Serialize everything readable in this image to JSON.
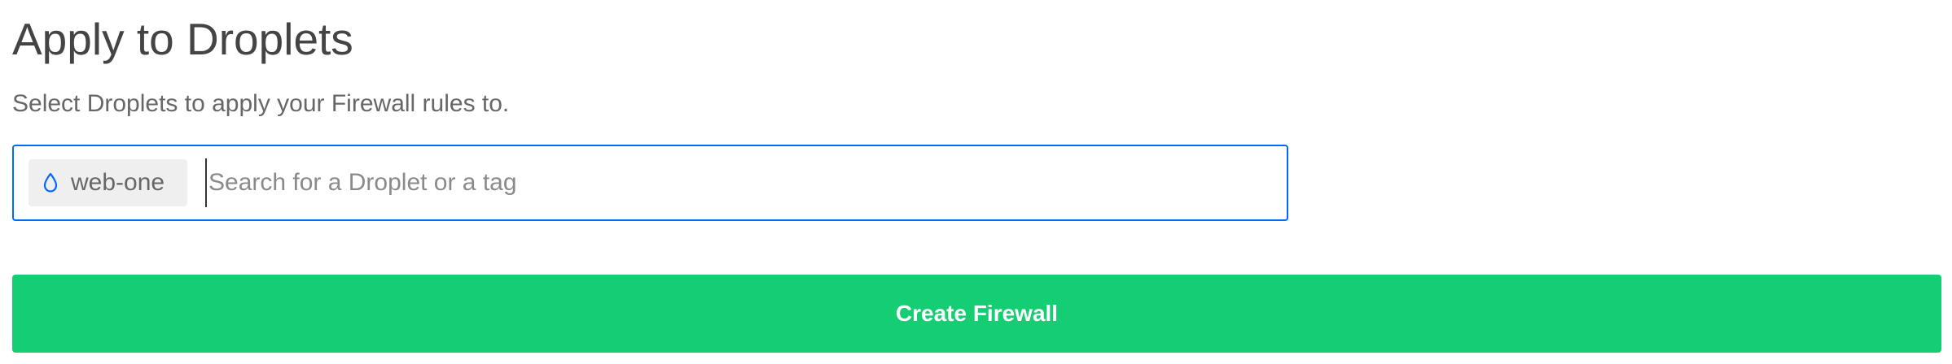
{
  "section": {
    "title": "Apply to Droplets",
    "description": "Select Droplets to apply your Firewall rules to."
  },
  "droplet_search": {
    "selected_chips": [
      {
        "label": "web-one",
        "icon": "droplet-icon"
      }
    ],
    "placeholder": "Search for a Droplet or a tag",
    "value": ""
  },
  "actions": {
    "create_label": "Create Firewall"
  },
  "colors": {
    "heading": "#444444",
    "subtext": "#676767",
    "input_border_focus": "#0069ff",
    "chip_background": "#efefef",
    "droplet_icon": "#0069ff",
    "primary_button": "#15cd72",
    "primary_button_text": "#ffffff"
  }
}
